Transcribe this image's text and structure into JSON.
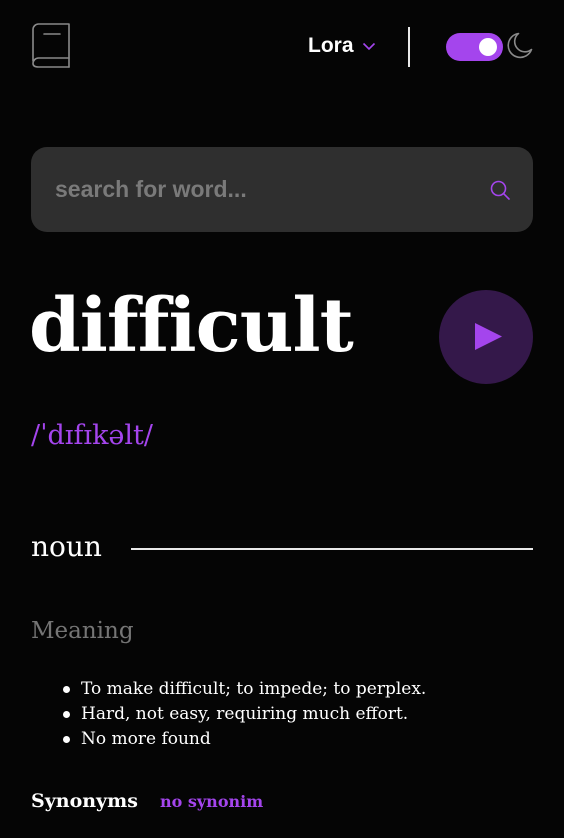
{
  "header": {
    "logo_icon": "book-icon",
    "font_selector": {
      "label": "Lora",
      "icon": "chevron-down-icon"
    },
    "theme_toggle": {
      "state": "dark",
      "accent": "#a445ed"
    },
    "theme_icon": "moon-icon"
  },
  "search": {
    "placeholder": "search for word...",
    "value": "",
    "icon": "search-icon"
  },
  "entry": {
    "word": "difficult",
    "phonetic": "/ˈdɪfɪkəlt/",
    "play_icon": "play-icon",
    "part_of_speech": "noun",
    "meaning_heading": "Meaning",
    "meanings": [
      "To make difficult; to impede; to perplex.",
      "Hard, not easy, requiring much effort.",
      "No more found"
    ],
    "synonyms_label": "Synonyms",
    "synonyms_value": "no synonim"
  },
  "colors": {
    "background": "#050505",
    "accent": "#a445ed",
    "search_bg": "#2f2f2f",
    "muted_text": "#757575",
    "play_bg": "#34184a"
  }
}
